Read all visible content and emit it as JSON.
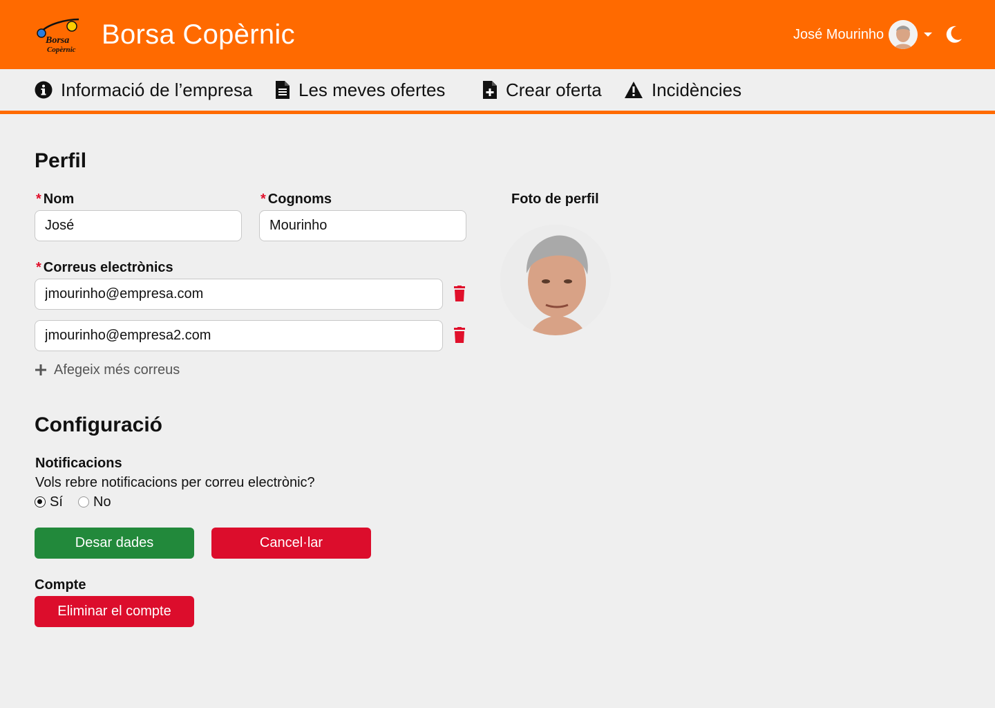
{
  "header": {
    "app_title": "Borsa Copèrnic",
    "logo_text_line1": "Borsa",
    "logo_text_line2": "Copèrnic",
    "user_name": "José Mourinho",
    "theme_icon": "moon-icon",
    "accent_color": "#ff6a00"
  },
  "nav": {
    "items": [
      {
        "label": "Informació de l’empresa",
        "icon": "info-circle-icon"
      },
      {
        "label": "Les meves ofertes",
        "icon": "document-icon"
      },
      {
        "label": "Crear oferta",
        "icon": "document-plus-icon"
      },
      {
        "label": "Incidències",
        "icon": "warning-icon"
      }
    ]
  },
  "profile": {
    "title": "Perfil",
    "first_name_label": "Nom",
    "first_name_value": "José",
    "last_name_label": "Cognoms",
    "last_name_value": "Mourinho",
    "emails_label": "Correus electrònics",
    "emails": [
      "jmourinho@empresa.com",
      "jmourinho@empresa2.com"
    ],
    "add_email_label": "Afegeix més correus",
    "photo_label": "Foto de perfil"
  },
  "settings": {
    "title": "Configuració",
    "notifications_title": "Notificacions",
    "notifications_question": "Vols rebre notificacions per correu electrònic?",
    "options": [
      "Sí",
      "No"
    ],
    "selected_option": "Sí",
    "save_label": "Desar dades",
    "cancel_label": "Cancel·lar",
    "account_title": "Compte",
    "delete_account_label": "Eliminar el compte"
  },
  "colors": {
    "primary_orange": "#ff6a00",
    "success_green": "#22893b",
    "danger_red": "#dc0d2c"
  }
}
